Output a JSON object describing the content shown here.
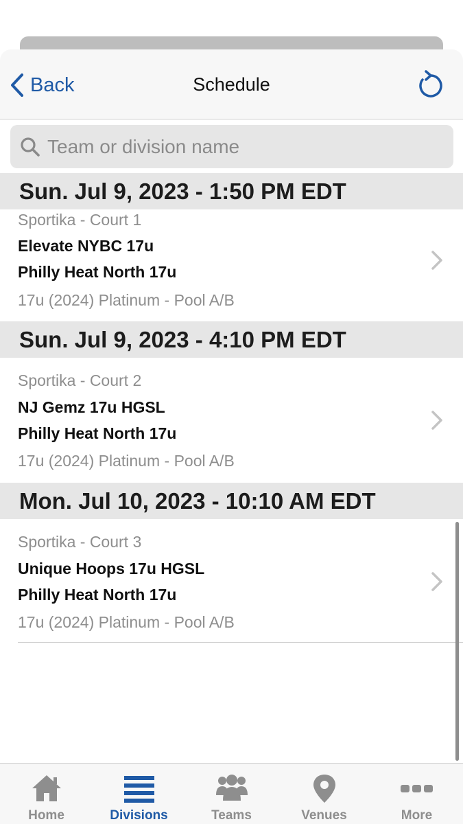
{
  "navbar": {
    "back_label": "Back",
    "title": "Schedule"
  },
  "search": {
    "placeholder": "Team or division name",
    "value": ""
  },
  "sections": [
    {
      "header": "Sun. Jul 9, 2023 - 1:50 PM EDT",
      "games": [
        {
          "venue": "Sportika - Court 1",
          "team1": "Elevate NYBC 17u",
          "team2": "Philly Heat North 17u",
          "division": "17u (2024) Platinum - Pool A/B"
        }
      ]
    },
    {
      "header": "Sun. Jul 9, 2023 - 4:10 PM EDT",
      "games": [
        {
          "venue": "Sportika - Court 2",
          "team1": "NJ Gemz 17u HGSL",
          "team2": "Philly Heat North 17u",
          "division": "17u (2024) Platinum - Pool A/B"
        }
      ]
    },
    {
      "header": "Mon. Jul 10, 2023 - 10:10 AM EDT",
      "games": [
        {
          "venue": "Sportika - Court 3",
          "team1": "Unique Hoops 17u HGSL",
          "team2": "Philly Heat North 17u",
          "division": "17u (2024) Platinum - Pool A/B"
        }
      ]
    }
  ],
  "tabbar": {
    "tabs": [
      {
        "label": "Home",
        "icon": "home-icon",
        "active": false
      },
      {
        "label": "Divisions",
        "icon": "list-icon",
        "active": true
      },
      {
        "label": "Teams",
        "icon": "group-icon",
        "active": false
      },
      {
        "label": "Venues",
        "icon": "map-pin-icon",
        "active": false
      },
      {
        "label": "More",
        "icon": "more-dots-icon",
        "active": false
      }
    ]
  },
  "colors": {
    "accent": "#1f5aa6",
    "inactive": "#8e8e8e",
    "section_bg": "#e6e6e6"
  }
}
